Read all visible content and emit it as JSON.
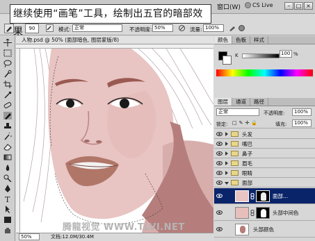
{
  "caption": "继续使用“画笔”工具，绘制出五官的暗部效果",
  "menubar": {
    "window_menu": "窗口(W)",
    "cs_live": "CS Live"
  },
  "options": {
    "brush_size": "90",
    "mode_label": "模式:",
    "mode_value": "正常",
    "opacity_label": "不透明度:",
    "opacity_value": "50%",
    "flow_label": "流量:",
    "flow_value": "100%"
  },
  "document": {
    "tab_title": "人物.psd @ 50% (面部暗色, 图层蒙版/8)",
    "zoom": "50%",
    "doc_size": "文档:12.0M/30.4M"
  },
  "watermark": "腾龍视觉 WWW.TLVI.NET",
  "color_panel": {
    "tabs": [
      "颜色",
      "色板",
      "样式"
    ],
    "k_label": "K",
    "k_value": "100",
    "k_unit": "%"
  },
  "layers_panel": {
    "tabs": [
      "图层",
      "通道",
      "路径"
    ],
    "blend_mode": "正常",
    "opacity_label": "不透明度:",
    "opacity_value": "100%",
    "lock_label": "锁定:",
    "fill_label": "填充:",
    "fill_value": "100%",
    "layers": [
      {
        "name": "头发",
        "type": "group"
      },
      {
        "name": "嘴巴",
        "type": "group"
      },
      {
        "name": "鼻子",
        "type": "group"
      },
      {
        "name": "眉毛",
        "type": "group"
      },
      {
        "name": "眼睛",
        "type": "group"
      },
      {
        "name": "面部",
        "type": "group-open"
      },
      {
        "name": "面部...",
        "type": "layer-mask",
        "selected": true
      },
      {
        "name": "头部中间色",
        "type": "layer-mask"
      },
      {
        "name": "头部颜色",
        "type": "layer"
      }
    ]
  },
  "colors": {
    "selected_layer": "#0a246a",
    "skin": "#e8c4c2",
    "skin_shadow": "#b57e7c",
    "lips": "#b07668"
  }
}
